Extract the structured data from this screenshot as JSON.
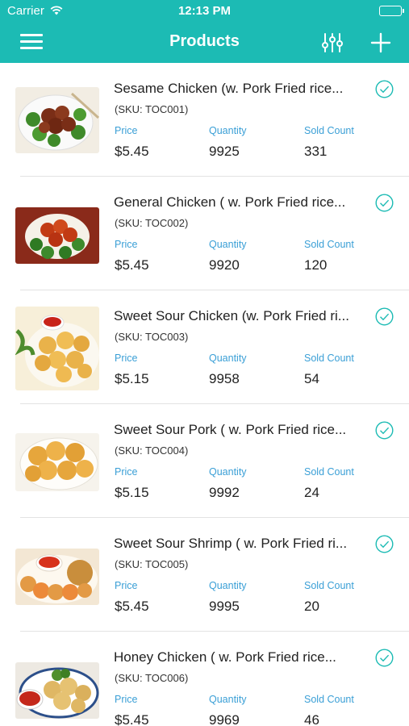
{
  "status": {
    "carrier": "Carrier",
    "time": "12:13 PM"
  },
  "nav": {
    "title": "Products"
  },
  "columns": {
    "price": "Price",
    "quantity": "Quantity",
    "sold": "Sold Count"
  },
  "accent_color": "#1cbbb4",
  "label_color": "#3a9fd6",
  "products": [
    {
      "name": "Sesame Chicken  (w. Pork Fried rice...",
      "sku": "(SKU: TOC001)",
      "price": "$5.45",
      "quantity": "9925",
      "sold": "331",
      "selected": true
    },
    {
      "name": "General Chicken  ( w. Pork Fried rice...",
      "sku": "(SKU: TOC002)",
      "price": "$5.45",
      "quantity": "9920",
      "sold": "120",
      "selected": true
    },
    {
      "name": "Sweet Sour Chicken (w. Pork Fried ri...",
      "sku": "(SKU: TOC003)",
      "price": "$5.15",
      "quantity": "9958",
      "sold": "54",
      "selected": true
    },
    {
      "name": "Sweet Sour Pork  ( w. Pork Fried rice...",
      "sku": "(SKU: TOC004)",
      "price": "$5.15",
      "quantity": "9992",
      "sold": "24",
      "selected": true
    },
    {
      "name": "Sweet Sour Shrimp ( w. Pork Fried ri...",
      "sku": "(SKU: TOC005)",
      "price": "$5.45",
      "quantity": "9995",
      "sold": "20",
      "selected": true
    },
    {
      "name": "Honey Chicken  (  w. Pork Fried rice...",
      "sku": "(SKU: TOC006)",
      "price": "$5.45",
      "quantity": "9969",
      "sold": "46",
      "selected": true
    }
  ]
}
